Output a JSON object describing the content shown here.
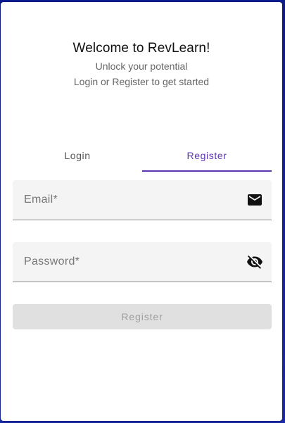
{
  "header": {
    "title": "Welcome to RevLearn!",
    "subtitle_line1": "Unlock your potential",
    "subtitle_line2": "Login or Register to get started"
  },
  "tabs": [
    {
      "label": "Login",
      "active": false
    },
    {
      "label": "Register",
      "active": true
    }
  ],
  "form": {
    "email": {
      "placeholder": "Email*",
      "value": "",
      "icon": "email-icon"
    },
    "password": {
      "placeholder": "Password*",
      "value": "",
      "icon": "visibility-off-icon"
    },
    "submit_label": "Register",
    "submit_disabled": true
  },
  "colors": {
    "accent": "#5e35b1",
    "background": "#1a237e",
    "card": "#ffffff",
    "field_bg": "#f4f4f4",
    "button_disabled_bg": "#e0e0e0",
    "button_disabled_text": "#9e9e9e"
  }
}
